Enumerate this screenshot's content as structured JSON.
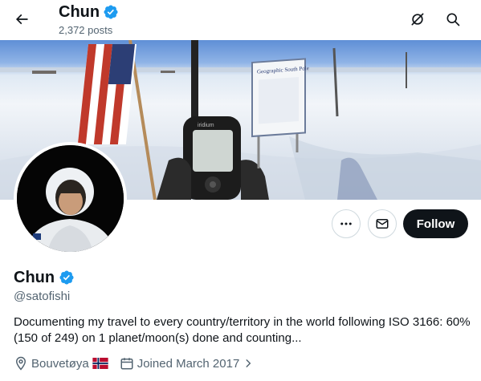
{
  "header": {
    "name": "Chun",
    "post_count": "2,372 posts"
  },
  "banner": {
    "sign_text": "Geographic South Pole",
    "device_label": "iridium"
  },
  "actions": {
    "follow_label": "Follow"
  },
  "profile": {
    "name": "Chun",
    "handle": "@satofishi",
    "bio": "Documenting my travel to every country/territory in the world following ISO 3166: 60% (150 of 249) on 1 planet/moon(s) done and counting...",
    "location": "Bouvetøya",
    "joined": "Joined March 2017"
  },
  "colors": {
    "verified": "#1d9bf0",
    "text_primary": "#0f1419",
    "text_secondary": "#536471",
    "follow_bg": "#0f1419"
  },
  "icons": {
    "back": "arrow-left-icon",
    "edit": "pen-slash-icon",
    "search": "search-icon",
    "more": "more-horizontal-icon",
    "message": "envelope-icon",
    "location": "map-pin-icon",
    "calendar": "calendar-icon",
    "flag": "norway-flag-icon",
    "verified": "verified-badge-icon"
  }
}
